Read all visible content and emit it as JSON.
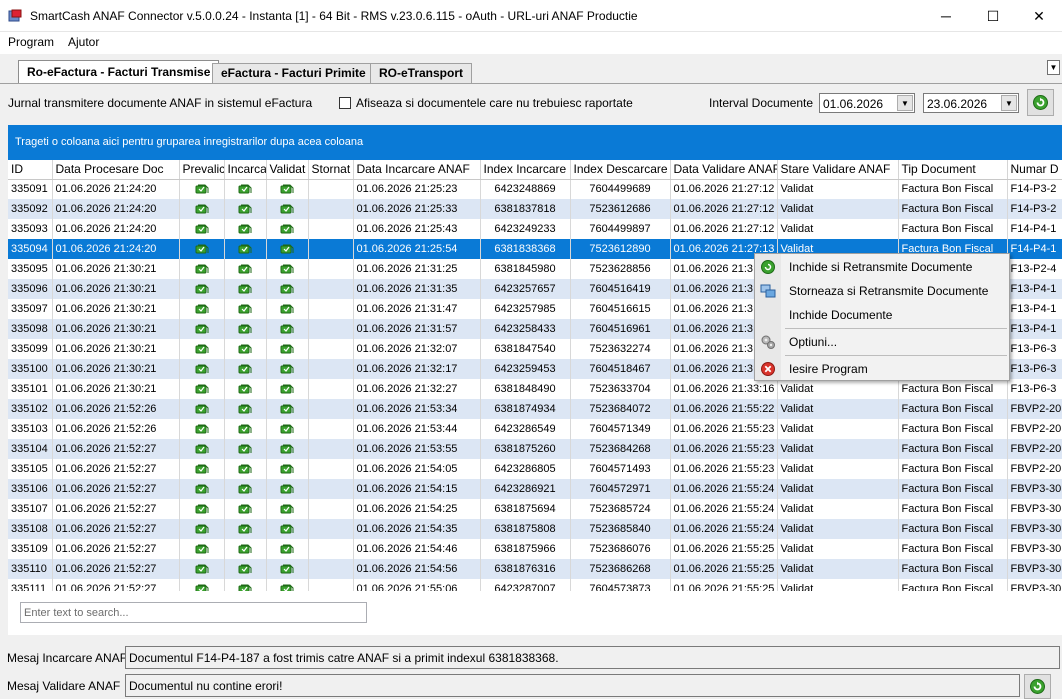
{
  "window": {
    "title": "SmartCash ANAF Connector v.5.0.0.24 - Instanta [1]  - 64 Bit - RMS v.23.0.6.115 - oAuth - URL-uri ANAF Productie",
    "minimize": "─",
    "maximize": "☐",
    "close": "✕"
  },
  "menu": {
    "program": "Program",
    "help": "Ajutor"
  },
  "tabs": [
    {
      "label": "Ro-eFactura - Facturi Transmise"
    },
    {
      "label": "eFactura - Facturi Primite"
    },
    {
      "label": "RO-eTransport"
    }
  ],
  "toolbar": {
    "journal_label": "Jurnal transmitere documente ANAF in sistemul eFactura",
    "show_unreported_label": "Afiseaza si documentele care nu trebuiesc raportate",
    "interval_label": "Interval Documente",
    "date_from": "01.06.2026",
    "date_to": "23.06.2026"
  },
  "group_hint": "Trageti o coloana aici pentru gruparea inregistrarilor dupa acea coloana",
  "grid": {
    "columns": [
      "ID",
      "Data Procesare Doc",
      "Prevalic",
      "Incarca",
      "Validat",
      "Stornat",
      "Data Incarcare ANAF",
      "Index Incarcare",
      "Index Descarcare I",
      "Data Validare ANAF",
      "Stare Validare ANAF",
      "Tip Document",
      "Numar D"
    ],
    "rows": [
      {
        "id": "335091",
        "proc": "01.06.2026 21:24:20",
        "inc": "01.06.2026 21:25:23",
        "idxi": "6423248869",
        "idxd": "7604499689",
        "val": "01.06.2026 21:27:12",
        "stare": "Validat",
        "tip": "Factura Bon Fiscal",
        "nr": "F14-P3-2"
      },
      {
        "id": "335092",
        "proc": "01.06.2026 21:24:20",
        "inc": "01.06.2026 21:25:33",
        "idxi": "6381837818",
        "idxd": "7523612686",
        "val": "01.06.2026 21:27:12",
        "stare": "Validat",
        "tip": "Factura Bon Fiscal",
        "nr": "F14-P3-2"
      },
      {
        "id": "335093",
        "proc": "01.06.2026 21:24:20",
        "inc": "01.06.2026 21:25:43",
        "idxi": "6423249233",
        "idxd": "7604499897",
        "val": "01.06.2026 21:27:12",
        "stare": "Validat",
        "tip": "Factura Bon Fiscal",
        "nr": "F14-P4-1"
      },
      {
        "id": "335094",
        "proc": "01.06.2026 21:24:20",
        "inc": "01.06.2026 21:25:54",
        "idxi": "6381838368",
        "idxd": "7523612890",
        "val": "01.06.2026 21:27:13",
        "stare": "Validat",
        "tip": "Factura Bon Fiscal",
        "nr": "F14-P4-1"
      },
      {
        "id": "335095",
        "proc": "01.06.2026 21:30:21",
        "inc": "01.06.2026 21:31:25",
        "idxi": "6381845980",
        "idxd": "7523628856",
        "val": "01.06.2026 21:3",
        "stare": "",
        "tip": "",
        "nr": "F13-P2-4"
      },
      {
        "id": "335096",
        "proc": "01.06.2026 21:30:21",
        "inc": "01.06.2026 21:31:35",
        "idxi": "6423257657",
        "idxd": "7604516419",
        "val": "01.06.2026 21:3",
        "stare": "",
        "tip": "",
        "nr": "F13-P4-1"
      },
      {
        "id": "335097",
        "proc": "01.06.2026 21:30:21",
        "inc": "01.06.2026 21:31:47",
        "idxi": "6423257985",
        "idxd": "7604516615",
        "val": "01.06.2026 21:3",
        "stare": "",
        "tip": "",
        "nr": "F13-P4-1"
      },
      {
        "id": "335098",
        "proc": "01.06.2026 21:30:21",
        "inc": "01.06.2026 21:31:57",
        "idxi": "6423258433",
        "idxd": "7604516961",
        "val": "01.06.2026 21:3",
        "stare": "",
        "tip": "",
        "nr": "F13-P4-1"
      },
      {
        "id": "335099",
        "proc": "01.06.2026 21:30:21",
        "inc": "01.06.2026 21:32:07",
        "idxi": "6381847540",
        "idxd": "7523632274",
        "val": "01.06.2026 21:3",
        "stare": "",
        "tip": "",
        "nr": "F13-P6-3"
      },
      {
        "id": "335100",
        "proc": "01.06.2026 21:30:21",
        "inc": "01.06.2026 21:32:17",
        "idxi": "6423259453",
        "idxd": "7604518467",
        "val": "01.06.2026 21:3",
        "stare": "",
        "tip": "",
        "nr": "F13-P6-3"
      },
      {
        "id": "335101",
        "proc": "01.06.2026 21:30:21",
        "inc": "01.06.2026 21:32:27",
        "idxi": "6381848490",
        "idxd": "7523633704",
        "val": "01.06.2026 21:33:16",
        "stare": "Validat",
        "tip": "Factura Bon Fiscal",
        "nr": "F13-P6-3"
      },
      {
        "id": "335102",
        "proc": "01.06.2026 21:52:26",
        "inc": "01.06.2026 21:53:34",
        "idxi": "6381874934",
        "idxd": "7523684072",
        "val": "01.06.2026 21:55:22",
        "stare": "Validat",
        "tip": "Factura Bon Fiscal",
        "nr": "FBVP2-20"
      },
      {
        "id": "335103",
        "proc": "01.06.2026 21:52:26",
        "inc": "01.06.2026 21:53:44",
        "idxi": "6423286549",
        "idxd": "7604571349",
        "val": "01.06.2026 21:55:23",
        "stare": "Validat",
        "tip": "Factura Bon Fiscal",
        "nr": "FBVP2-20"
      },
      {
        "id": "335104",
        "proc": "01.06.2026 21:52:27",
        "inc": "01.06.2026 21:53:55",
        "idxi": "6381875260",
        "idxd": "7523684268",
        "val": "01.06.2026 21:55:23",
        "stare": "Validat",
        "tip": "Factura Bon Fiscal",
        "nr": "FBVP2-20"
      },
      {
        "id": "335105",
        "proc": "01.06.2026 21:52:27",
        "inc": "01.06.2026 21:54:05",
        "idxi": "6423286805",
        "idxd": "7604571493",
        "val": "01.06.2026 21:55:23",
        "stare": "Validat",
        "tip": "Factura Bon Fiscal",
        "nr": "FBVP2-20"
      },
      {
        "id": "335106",
        "proc": "01.06.2026 21:52:27",
        "inc": "01.06.2026 21:54:15",
        "idxi": "6423286921",
        "idxd": "7604572971",
        "val": "01.06.2026 21:55:24",
        "stare": "Validat",
        "tip": "Factura Bon Fiscal",
        "nr": "FBVP3-30"
      },
      {
        "id": "335107",
        "proc": "01.06.2026 21:52:27",
        "inc": "01.06.2026 21:54:25",
        "idxi": "6381875694",
        "idxd": "7523685724",
        "val": "01.06.2026 21:55:24",
        "stare": "Validat",
        "tip": "Factura Bon Fiscal",
        "nr": "FBVP3-30"
      },
      {
        "id": "335108",
        "proc": "01.06.2026 21:52:27",
        "inc": "01.06.2026 21:54:35",
        "idxi": "6381875808",
        "idxd": "7523685840",
        "val": "01.06.2026 21:55:24",
        "stare": "Validat",
        "tip": "Factura Bon Fiscal",
        "nr": "FBVP3-30"
      },
      {
        "id": "335109",
        "proc": "01.06.2026 21:52:27",
        "inc": "01.06.2026 21:54:46",
        "idxi": "6381875966",
        "idxd": "7523686076",
        "val": "01.06.2026 21:55:25",
        "stare": "Validat",
        "tip": "Factura Bon Fiscal",
        "nr": "FBVP3-30"
      },
      {
        "id": "335110",
        "proc": "01.06.2026 21:52:27",
        "inc": "01.06.2026 21:54:56",
        "idxi": "6381876316",
        "idxd": "7523686268",
        "val": "01.06.2026 21:55:25",
        "stare": "Validat",
        "tip": "Factura Bon Fiscal",
        "nr": "FBVP3-30"
      },
      {
        "id": "335111",
        "proc": "01.06.2026 21:52:27",
        "inc": "01.06.2026 21:55:06",
        "idxi": "6423287007",
        "idxd": "7604573873",
        "val": "01.06.2026 21:55:25",
        "stare": "Validat",
        "tip": "Factura Bon Fiscal",
        "nr": "FBVP3-30"
      }
    ]
  },
  "search": {
    "placeholder": "Enter text to search..."
  },
  "context_menu": {
    "close_retransmit": "Inchide si Retransmite Documente",
    "storno_retransmit": "Storneaza si Retransmite Documente",
    "close_docs": "Inchide Documente",
    "options": "Optiuni...",
    "exit": "Iesire Program"
  },
  "messages": {
    "upload_label": "Mesaj Incarcare ANAF",
    "upload_text": "Documentul F14-P4-187 a fost trimis catre ANAF si a primit indexul 6381838368.",
    "validation_label": "Mesaj Validare ANAF",
    "validation_text": "Documentul nu contine erori!"
  },
  "colors": {
    "accent": "#0a7ad6",
    "alt_row": "#dce6f4",
    "status_icon": "#3aa12e"
  }
}
